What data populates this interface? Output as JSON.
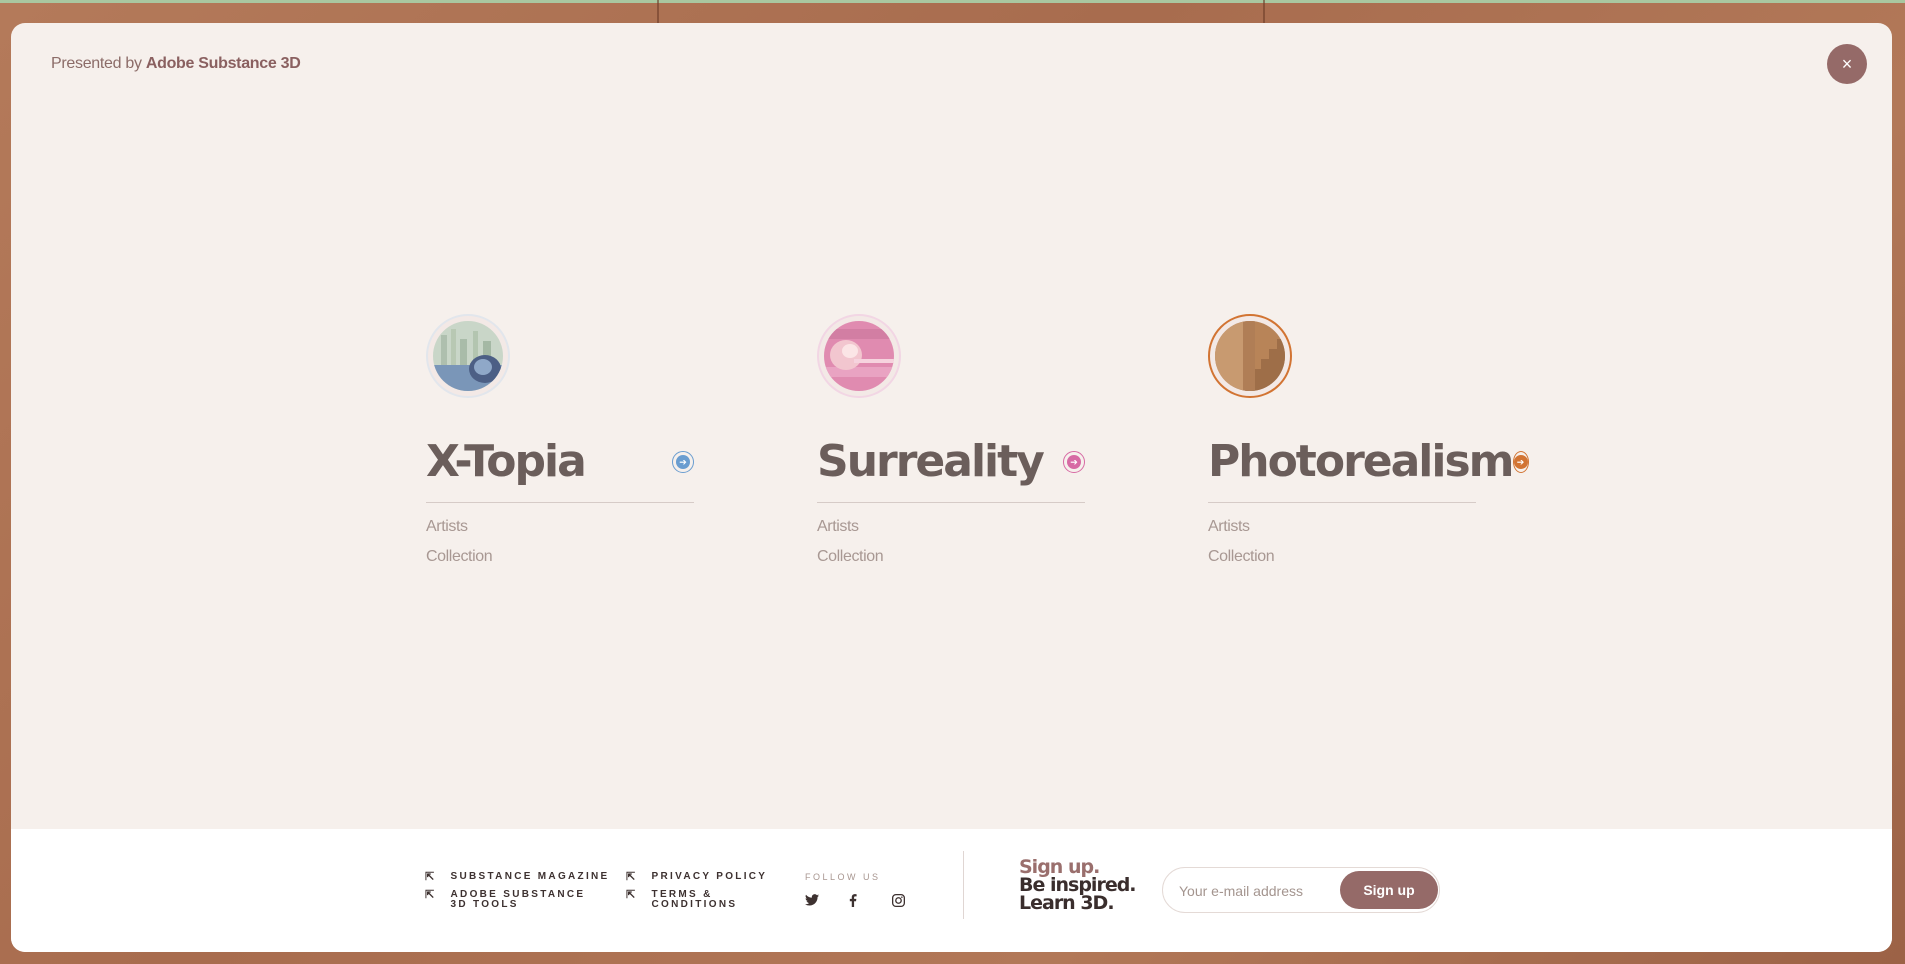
{
  "header": {
    "presented_prefix": "Presented by",
    "presented_brand": "Adobe Substance 3D",
    "close_label": "×"
  },
  "categories": [
    {
      "title": "X-Topia",
      "accent": "#6a9dd0",
      "links": [
        "Artists",
        "Collection"
      ],
      "arrow": "➔"
    },
    {
      "title": "Surreality",
      "accent": "#d76aa4",
      "links": [
        "Artists",
        "Collection"
      ],
      "arrow": "➔"
    },
    {
      "title": "Photorealism",
      "accent": "#d27433",
      "links": [
        "Artists",
        "Collection"
      ],
      "arrow": "➔"
    }
  ],
  "footer": {
    "links": [
      "SUBSTANCE MAGAZINE",
      "ADOBE SUBSTANCE 3D TOOLS",
      "PRIVACY POLICY",
      "TERMS & CONDITIONS"
    ],
    "follow_label": "FOLLOW US",
    "social_icons": [
      "twitter-icon",
      "facebook-icon",
      "instagram-icon"
    ],
    "tagline": [
      "Sign up.",
      "Be inspired.",
      "Learn 3D."
    ],
    "email_placeholder": "Your e-mail address",
    "signup_label": "Sign up"
  },
  "colors": {
    "brand": "#956a68",
    "title_text": "#6b5e5b",
    "modal_bg": "#f6f0ec"
  }
}
